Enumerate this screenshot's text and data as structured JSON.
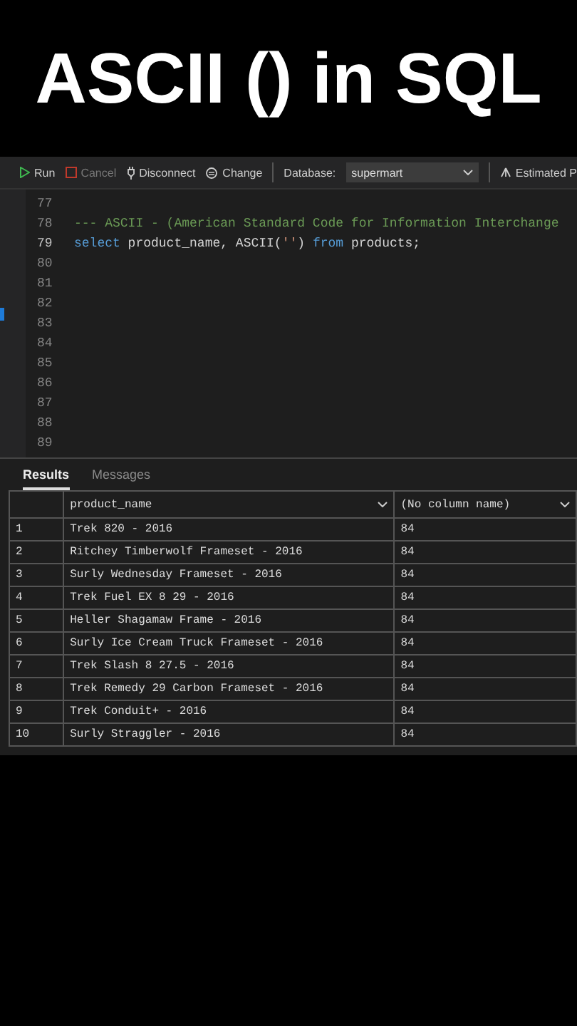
{
  "title": "ASCII () in SQL",
  "toolbar": {
    "buttons": [
      {
        "label": "Run",
        "kind": "run",
        "disabled": false
      },
      {
        "label": "Cancel",
        "kind": "cancel",
        "disabled": true
      },
      {
        "label": "Disconnect",
        "kind": "disconnect",
        "disabled": false
      },
      {
        "label": "Change",
        "kind": "change",
        "disabled": false
      }
    ],
    "database_label": "Database:",
    "database": "supermart",
    "estimated": "Estimated P"
  },
  "editor": {
    "lines": [
      {
        "number": "77",
        "current": false
      },
      {
        "number": "78",
        "current": false,
        "tokens": [
          {
            "text": "--- ASCII - (American Standard Code for Information Interchange",
            "kind": "comment"
          }
        ]
      },
      {
        "number": "79",
        "current": true,
        "tokens": [
          {
            "text": "select",
            "kind": "keyword"
          },
          {
            "text": " product_name, ASCII(",
            "kind": "plain"
          },
          {
            "text": "''",
            "kind": "string"
          },
          {
            "text": ") ",
            "kind": "plain"
          },
          {
            "text": "from",
            "kind": "keyword"
          },
          {
            "text": " products;",
            "kind": "plain"
          }
        ]
      },
      {
        "number": "80",
        "current": false
      },
      {
        "number": "81",
        "current": false
      },
      {
        "number": "82",
        "current": false
      },
      {
        "number": "83",
        "current": false
      },
      {
        "number": "84",
        "current": false
      },
      {
        "number": "85",
        "current": false
      },
      {
        "number": "86",
        "current": false
      },
      {
        "number": "87",
        "current": false
      },
      {
        "number": "88",
        "current": false
      },
      {
        "number": "89",
        "current": false
      }
    ]
  },
  "result_tabs": [
    {
      "label": "Results",
      "selected": true
    },
    {
      "label": "Messages",
      "selected": false
    }
  ],
  "table": {
    "columns": [
      "",
      "product_name",
      "(No column name)"
    ],
    "rows": [
      [
        "1",
        "Trek 820 - 2016",
        "84"
      ],
      [
        "2",
        "Ritchey Timberwolf Frameset - 2016",
        "84"
      ],
      [
        "3",
        "Surly Wednesday Frameset - 2016",
        "84"
      ],
      [
        "4",
        "Trek Fuel EX 8 29 - 2016",
        "84"
      ],
      [
        "5",
        "Heller Shagamaw Frame - 2016",
        "84"
      ],
      [
        "6",
        "Surly Ice Cream Truck Frameset - 2016",
        "84"
      ],
      [
        "7",
        "Trek Slash 8 27.5 - 2016",
        "84"
      ],
      [
        "8",
        "Trek Remedy 29 Carbon Frameset - 2016",
        "84"
      ],
      [
        "9",
        "Trek Conduit+ - 2016",
        "84"
      ],
      [
        "10",
        "Surly Straggler - 2016",
        "84"
      ]
    ]
  }
}
